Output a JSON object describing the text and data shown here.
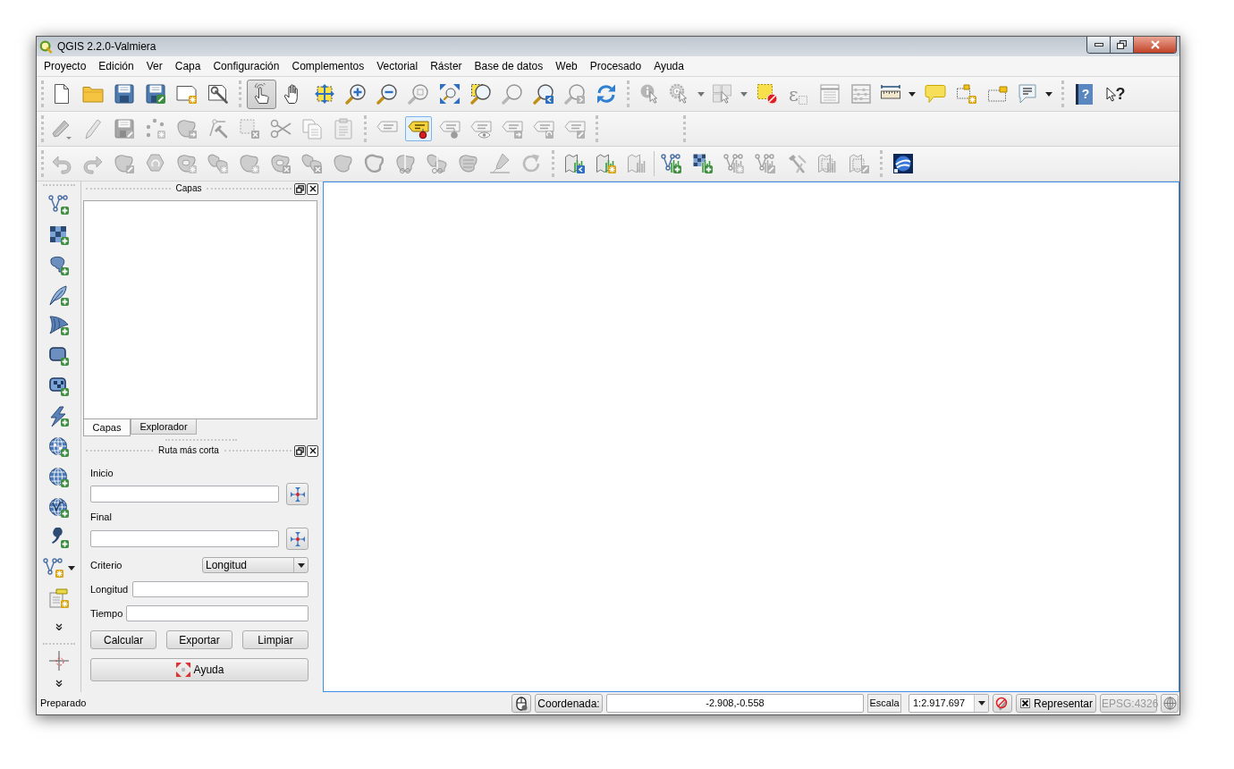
{
  "window": {
    "title": "QGIS 2.2.0-Valmiera"
  },
  "menu": [
    "Proyecto",
    "Edición",
    "Ver",
    "Capa",
    "Configuración",
    "Complementos",
    "Vectorial",
    "Ráster",
    "Base de datos",
    "Web",
    "Procesado",
    "Ayuda"
  ],
  "toolbars": [
    {
      "items": [
        {
          "selected": false,
          "disabled": false
        },
        {
          "selected": false,
          "disabled": false
        },
        {
          "selected": false,
          "disabled": false
        },
        {
          "selected": false,
          "disabled": false
        },
        {
          "selected": false,
          "disabled": false
        },
        {
          "selected": false,
          "disabled": false
        },
        {
          "selected": true,
          "disabled": false
        },
        {
          "selected": false,
          "disabled": false
        },
        {
          "selected": false,
          "disabled": false
        },
        {
          "selected": false,
          "disabled": false
        },
        {
          "selected": false,
          "disabled": false
        },
        {
          "selected": false,
          "disabled": true
        },
        {
          "selected": false,
          "disabled": false
        },
        {
          "selected": false,
          "disabled": false
        },
        {
          "selected": false,
          "disabled": true
        },
        {
          "selected": false,
          "disabled": false
        },
        {
          "selected": false,
          "disabled": true
        },
        {
          "selected": false,
          "disabled": false
        },
        {
          "selected": false,
          "disabled": true
        },
        {
          "selected": false,
          "disabled": true
        },
        {
          "selected": false,
          "disabled": true
        },
        {
          "selected": false,
          "disabled": false
        },
        {
          "selected": false,
          "disabled": true,
          "glyph": "ε"
        },
        {
          "selected": false,
          "disabled": true
        },
        {
          "selected": false,
          "disabled": true
        },
        {
          "selected": false,
          "disabled": false
        },
        {
          "selected": false,
          "disabled": false
        },
        {
          "selected": false,
          "disabled": false
        },
        {
          "selected": false,
          "disabled": false
        },
        {
          "selected": false,
          "disabled": false
        },
        {
          "selected": false,
          "disabled": false,
          "glyph": "?"
        },
        {
          "selected": false,
          "disabled": false,
          "glyph": "?"
        }
      ]
    },
    {
      "items": [
        {
          "selected": false,
          "disabled": true
        },
        {
          "selected": false,
          "disabled": true
        },
        {
          "selected": false,
          "disabled": true
        },
        {
          "selected": false,
          "disabled": true
        },
        {
          "selected": false,
          "disabled": true
        },
        {
          "selected": false,
          "disabled": true
        },
        {
          "selected": false,
          "disabled": true
        },
        {
          "selected": false,
          "disabled": true
        },
        {
          "selected": false,
          "disabled": true
        },
        {
          "selected": false,
          "disabled": true
        },
        {
          "selected": false,
          "disabled": true
        },
        {
          "selected": true,
          "disabled": false
        },
        {
          "selected": false,
          "disabled": true
        },
        {
          "selected": false,
          "disabled": true
        },
        {
          "selected": false,
          "disabled": true
        },
        {
          "selected": false,
          "disabled": true
        },
        {
          "selected": false,
          "disabled": true
        }
      ]
    },
    {
      "items": [
        {
          "selected": false,
          "disabled": true
        },
        {
          "selected": false,
          "disabled": true
        },
        {
          "selected": false,
          "disabled": true
        },
        {
          "selected": false,
          "disabled": true
        },
        {
          "selected": false,
          "disabled": true
        },
        {
          "selected": false,
          "disabled": true
        },
        {
          "selected": false,
          "disabled": true
        },
        {
          "selected": false,
          "disabled": true
        },
        {
          "selected": false,
          "disabled": true
        },
        {
          "selected": false,
          "disabled": true
        },
        {
          "selected": false,
          "disabled": true
        },
        {
          "selected": false,
          "disabled": true
        },
        {
          "selected": false,
          "disabled": true
        },
        {
          "selected": false,
          "disabled": true
        },
        {
          "selected": false,
          "disabled": true
        },
        {
          "selected": false,
          "disabled": true
        },
        {
          "selected": false,
          "disabled": false
        },
        {
          "selected": false,
          "disabled": false
        },
        {
          "selected": false,
          "disabled": true
        },
        {
          "selected": false,
          "disabled": false
        },
        {
          "selected": false,
          "disabled": false
        },
        {
          "selected": false,
          "disabled": true
        },
        {
          "selected": false,
          "disabled": true
        },
        {
          "selected": false,
          "disabled": true
        },
        {
          "selected": false,
          "disabled": true
        },
        {
          "selected": false,
          "disabled": true
        },
        {
          "selected": false,
          "disabled": false
        }
      ]
    }
  ],
  "layers_panel": {
    "title": "Capas",
    "tabs": [
      {
        "label": "Capas",
        "selected": true
      },
      {
        "label": "Explorador",
        "selected": false
      }
    ]
  },
  "shortest_path_panel": {
    "title": "Ruta más corta",
    "start_label": "Inicio",
    "end_label": "Final",
    "criterion_label": "Criterio",
    "criterion_value": "Longitud",
    "length_label": "Longitud",
    "time_label": "Tiempo",
    "buttons": [
      "Calcular",
      "Exportar",
      "Limpiar"
    ],
    "help_button": "Ayuda"
  },
  "status_bar": {
    "message": "Preparado",
    "coordinate_label": "Coordenada:",
    "coordinate_value": "-2.908,-0.558",
    "scale_label": "Escala",
    "scale_value": "1:2.917.697",
    "render": {
      "label": "Representar",
      "checked": true
    },
    "crs": {
      "label": "EPSG:4326",
      "disabled": true
    }
  }
}
